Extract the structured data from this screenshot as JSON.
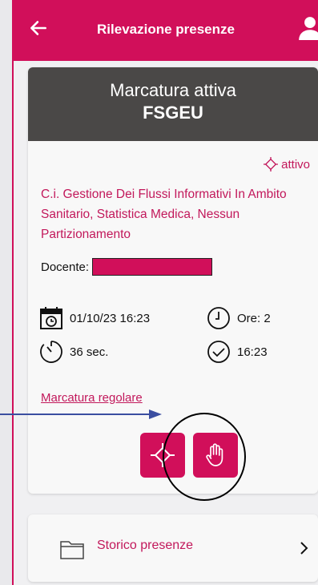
{
  "header": {
    "title": "Rilevazione presenze",
    "back_icon": "arrow-left-icon",
    "user_icon": "user-icon"
  },
  "card": {
    "title_line1": "Marcatura attiva",
    "title_line2": "FSGEU",
    "status": "attivo",
    "course": "C.i. Gestione Dei Flussi Informativi In Ambito Sanitario, Statistica Medica, Nessun Partizionamento",
    "teacher_label": "Docente:",
    "date": "01/10/23 16:23",
    "hours": "Ore: 2",
    "duration": "36 sec.",
    "time_check": "16:23",
    "link": "Marcatura regolare"
  },
  "storico": {
    "label": "Storico presenze"
  },
  "colors": {
    "accent": "#d10f5a",
    "header_dark": "#4a4847",
    "text_accent": "#c2185b"
  }
}
